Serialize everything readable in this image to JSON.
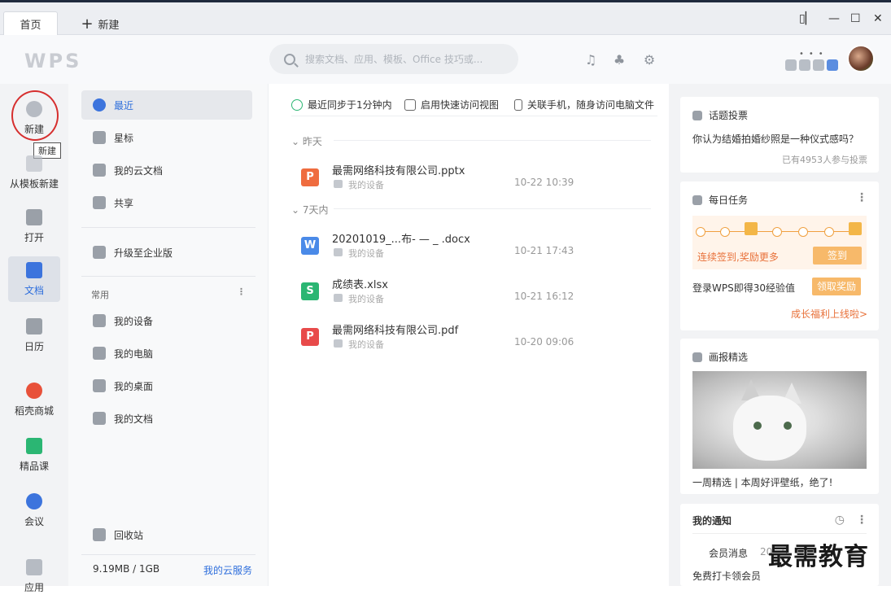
{
  "tabs": {
    "home": "首页",
    "new": "新建"
  },
  "search": {
    "placeholder": "搜索文档、应用、模板、Office 技巧或..."
  },
  "brand": {
    "logo": "WPS"
  },
  "leftnav": [
    {
      "label": "新建",
      "icon": "plus-circle-icon"
    },
    {
      "label": "从模板新建",
      "icon": "template-icon"
    },
    {
      "label": "打开",
      "icon": "folder-icon"
    },
    {
      "label": "文档",
      "icon": "document-icon"
    },
    {
      "label": "日历",
      "icon": "calendar-icon"
    },
    {
      "label": "稻壳商城",
      "icon": "shop-icon"
    },
    {
      "label": "精品课",
      "icon": "course-icon"
    },
    {
      "label": "会议",
      "icon": "meeting-icon"
    },
    {
      "label": "应用",
      "icon": "apps-icon"
    }
  ],
  "tooltip": "新建",
  "sidebar": {
    "items": [
      "最近",
      "星标",
      "我的云文档",
      "共享",
      "升级至企业版"
    ],
    "group_label": "常用",
    "common": [
      "我的设备",
      "我的电脑",
      "我的桌面",
      "我的文档"
    ],
    "trash": "回收站",
    "storage": "9.19MB / 1GB",
    "cloud_service": "我的云服务"
  },
  "toolbar": {
    "sync": "最近同步于1分钟内",
    "quick_view": "启用快速访问视图",
    "link_phone": "关联手机，随身访问电脑文件"
  },
  "sections": {
    "yesterday": "昨天",
    "week": "7天内"
  },
  "files": [
    {
      "name": "最需网络科技有限公司.pptx",
      "location": "我的设备",
      "date": "10-22 10:39",
      "type": "P",
      "color": "#ef6c3f"
    },
    {
      "name": "20201019_...布- — _ .docx",
      "location": "我的设备",
      "date": "10-21 17:43",
      "type": "W",
      "color": "#4a8ae8"
    },
    {
      "name": "成绩表.xlsx",
      "location": "我的设备",
      "date": "10-21 16:12",
      "type": "S",
      "color": "#2bb673"
    },
    {
      "name": "最需网络科技有限公司.pdf",
      "location": "我的设备",
      "date": "10-20 09:06",
      "type": "P",
      "color": "#e84a4a"
    }
  ],
  "vote": {
    "title": "话题投票",
    "question": "你认为结婚拍婚纱照是一种仪式感吗？",
    "count": "已有4953人参与投票"
  },
  "task": {
    "title": "每日任务",
    "streak": "连续签到,奖励更多",
    "sign": "签到",
    "login": "登录WPS即得30经验值",
    "claim": "领取奖励",
    "growth": "成长福利上线啦>"
  },
  "pictorial": {
    "title": "画报精选",
    "caption": "一周精选 | 本周好评壁纸，绝了!"
  },
  "notice": {
    "title": "我的通知",
    "member": "会员消息",
    "date": "20...9",
    "promo": "免费打卡领会员"
  },
  "watermark": "最需教育",
  "colors": {
    "accent": "#2f6fdc",
    "orange": "#f7b96a",
    "highlight": "#d62f2f"
  }
}
